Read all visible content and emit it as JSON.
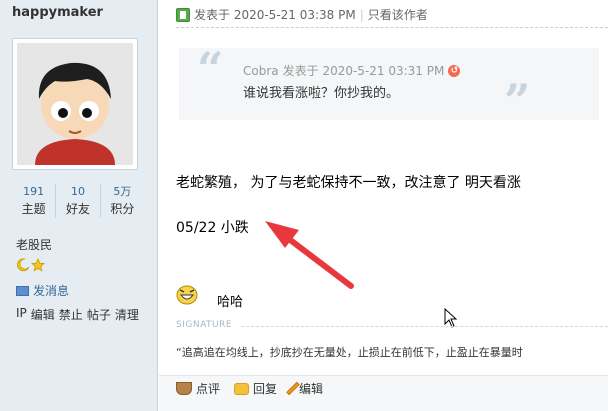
{
  "sidebar": {
    "username": "happymaker",
    "stats": [
      {
        "value": "191",
        "label": "主题"
      },
      {
        "value": "10",
        "label": "好友"
      },
      {
        "value": "5万",
        "label": "积分"
      }
    ],
    "rank": "老股民",
    "send_message": "发消息",
    "admin_links": [
      "IP",
      "编辑",
      "禁止",
      "帖子",
      "清理"
    ]
  },
  "post": {
    "posted_at": "发表于 2020-5-21 03:38 PM",
    "only_author": "只看该作者",
    "quote": {
      "author": "Cobra",
      "posted_at": "发表于 2020-5-21 03:31 PM",
      "text": "谁说我看涨啦？你抄我的。"
    },
    "line1": "老蛇繁殖， 为了与老蛇保持不一致，改注意了 明天看涨",
    "line2": "05/22  小跌",
    "emoji_text": "哈哈",
    "signature_label": "SIGNATURE",
    "signature_text": "“追高追在均线上，抄底抄在无量处，止损止在前低下，止盈止在暴量时"
  },
  "actions": {
    "rate": "点评",
    "reply": "回复",
    "edit": "编辑"
  },
  "colors": {
    "sidebar_bg": "#e5edf2",
    "link_blue": "#336699",
    "arrow_red": "#e8383d"
  }
}
